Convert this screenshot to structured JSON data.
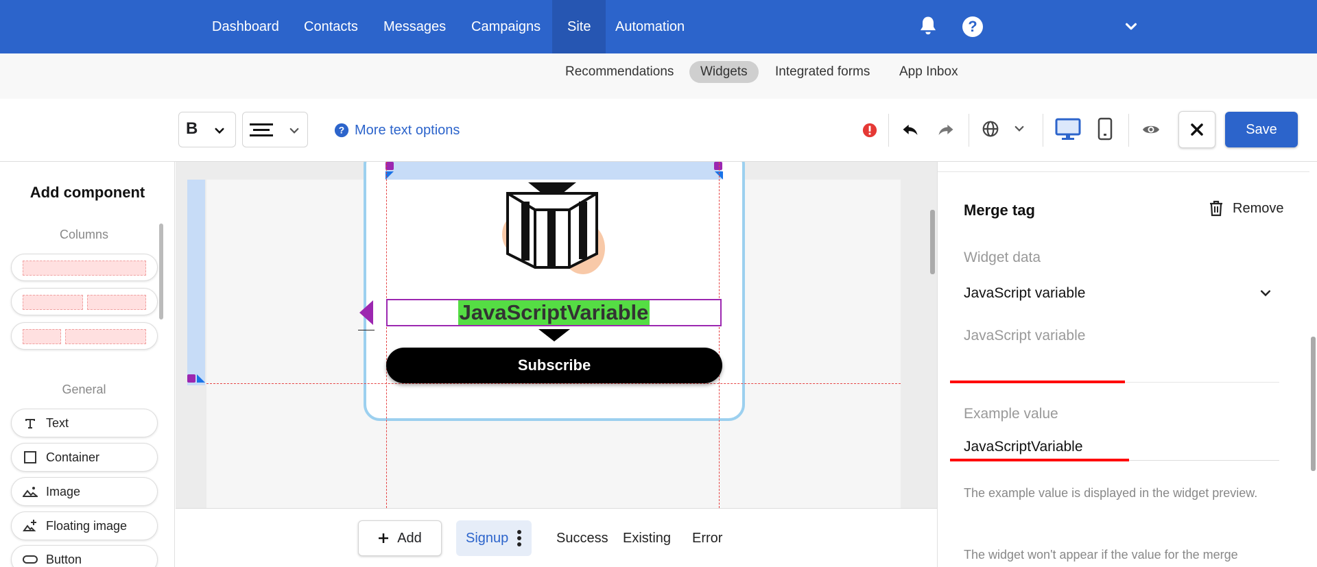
{
  "topnav": {
    "items": [
      {
        "label": "Dashboard"
      },
      {
        "label": "Contacts"
      },
      {
        "label": "Messages"
      },
      {
        "label": "Campaigns"
      },
      {
        "label": "Site"
      },
      {
        "label": "Automation"
      }
    ],
    "active": "Site",
    "help_glyph": "?"
  },
  "subnav": {
    "items": [
      {
        "label": "Recommendations"
      },
      {
        "label": "Widgets"
      },
      {
        "label": "Integrated forms"
      },
      {
        "label": "App Inbox"
      }
    ],
    "active": "Widgets"
  },
  "toolbar": {
    "bold_label": "B",
    "more_text_options": "More text options",
    "save_label": "Save"
  },
  "left_panel": {
    "title": "Add component",
    "columns_label": "Columns",
    "general_label": "General",
    "components": [
      {
        "label": "Text",
        "icon": "text-icon"
      },
      {
        "label": "Container",
        "icon": "container-icon"
      },
      {
        "label": "Image",
        "icon": "image-icon"
      },
      {
        "label": "Floating image",
        "icon": "floating-image-icon"
      },
      {
        "label": "Button",
        "icon": "button-icon"
      }
    ]
  },
  "canvas": {
    "variable_text": "JavaScriptVariable",
    "subscribe_label": "Subscribe"
  },
  "bottom_bar": {
    "add_label": "Add",
    "tabs": [
      {
        "label": "Signup"
      },
      {
        "label": "Success"
      },
      {
        "label": "Existing"
      },
      {
        "label": "Error"
      }
    ],
    "active": "Signup"
  },
  "right_panel": {
    "title": "Merge tag",
    "remove_label": "Remove",
    "widget_data_label": "Widget data",
    "widget_data_value": "JavaScript variable",
    "js_variable_label": "JavaScript variable",
    "js_variable_value": "",
    "example_value_label": "Example value",
    "example_value": "JavaScriptVariable",
    "help_text_1": "The example value is displayed in the widget preview.",
    "help_text_2": "The widget won't appear if the value for the merge"
  },
  "colors": {
    "brand_blue": "#2c64cb",
    "highlight_green": "#55dd44",
    "selection_purple": "#9c27b0",
    "annotation_red": "#ff0000"
  }
}
